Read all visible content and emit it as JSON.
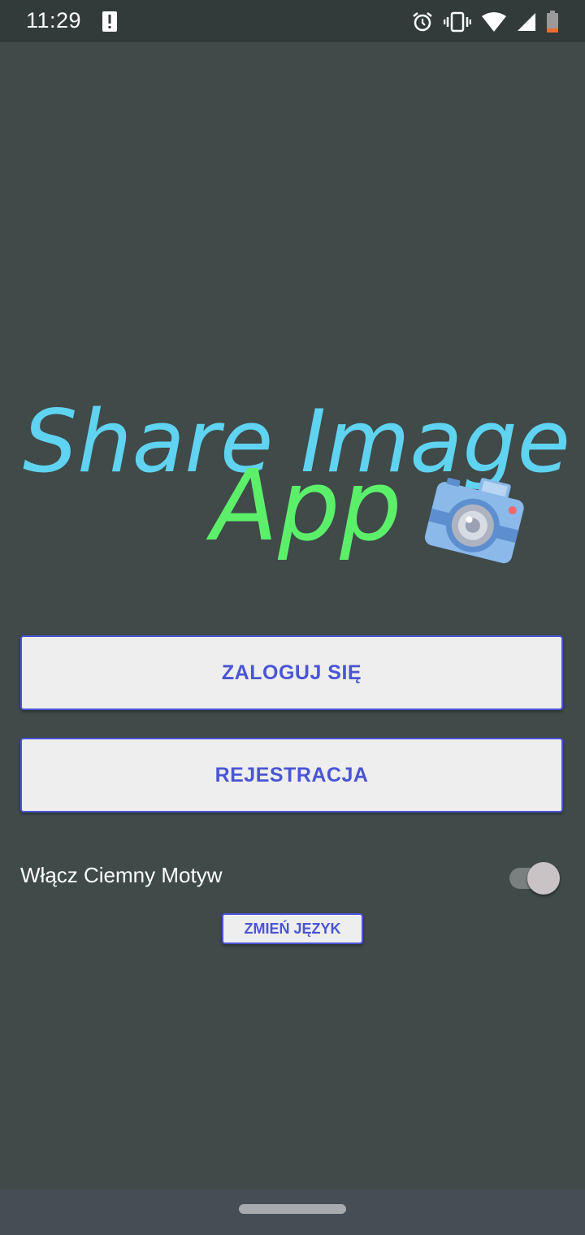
{
  "status_bar": {
    "time": "11:29",
    "icons": [
      "alert-icon",
      "alarm-icon",
      "vibrate-icon",
      "wifi-icon",
      "signal-icon",
      "battery-low-icon"
    ]
  },
  "logo": {
    "line1": "Share Image",
    "line2": "App",
    "colors": {
      "line1": "#5fd3f0",
      "line2": "#5cf06a"
    }
  },
  "buttons": {
    "login": "ZALOGUJ SIĘ",
    "register": "REJESTRACJA",
    "change_language": "ZMIEŃ JĘZYK"
  },
  "theme": {
    "label": "Włącz Ciemny Motyw",
    "enabled": true
  },
  "colors": {
    "background": "#3f4a49",
    "accent": "#4a55d4",
    "button_bg": "#eeeeee"
  }
}
